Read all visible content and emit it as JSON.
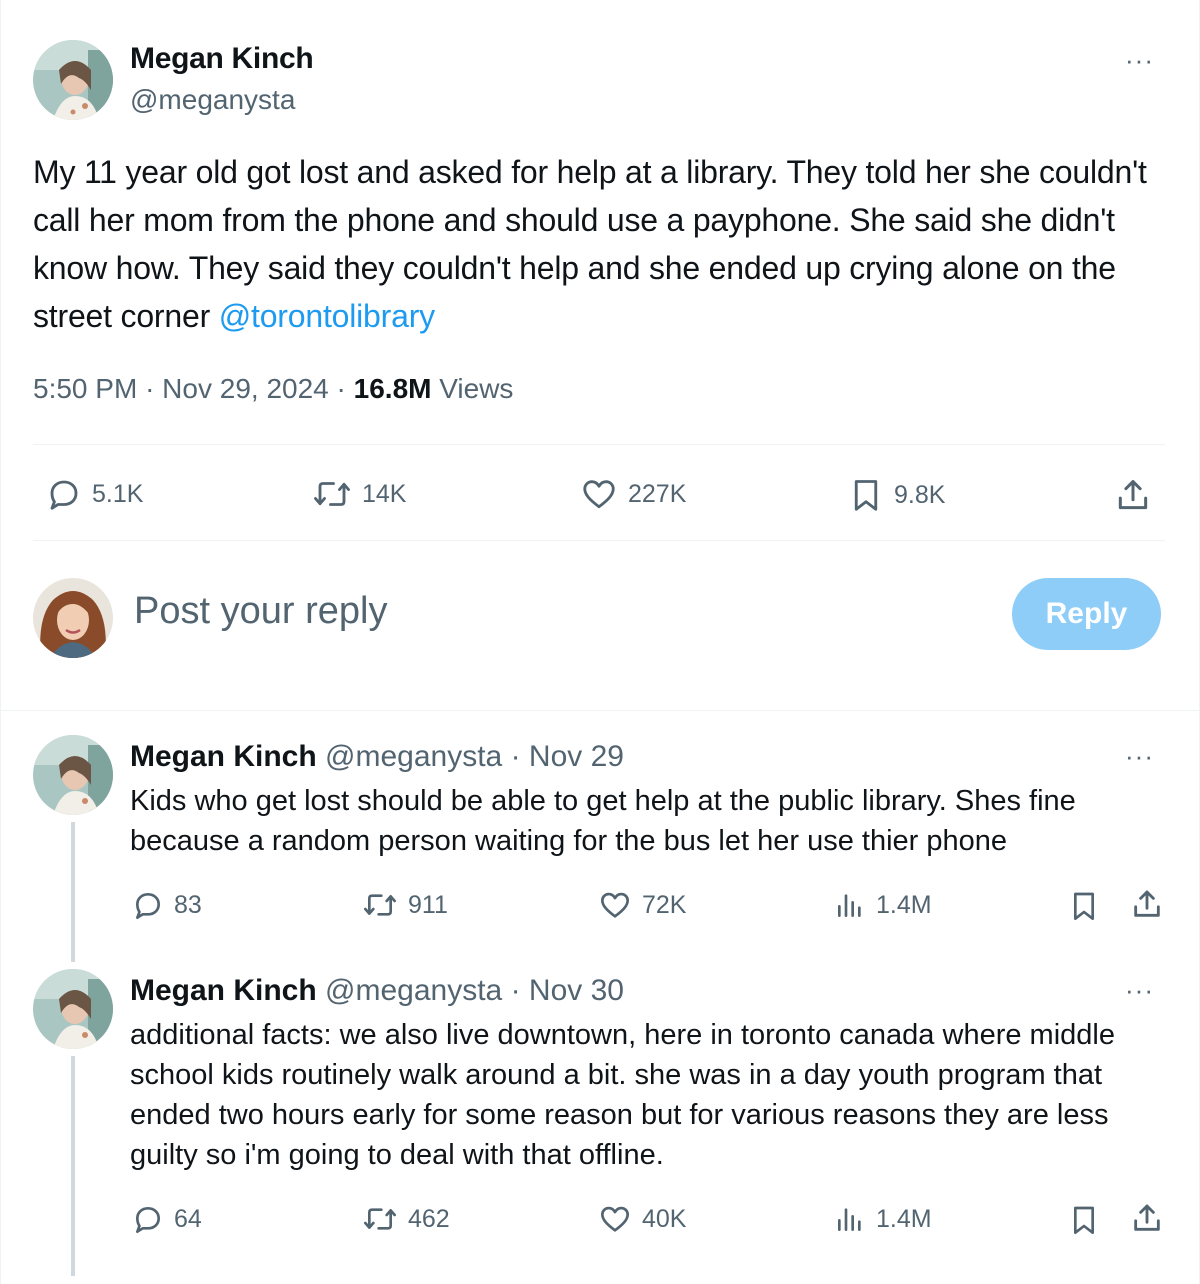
{
  "main_tweet": {
    "author_name": "Megan Kinch",
    "author_handle": "@meganysta",
    "text_before_mention": "My 11 year old got lost and asked for help at a library. They told her she couldn't call her mom from the phone and should use a payphone. She said she didn't know how. They said they couldn't help and she ended up crying alone on the street corner ",
    "mention": "@torontolibrary",
    "time": "5:50 PM",
    "date": "Nov 29, 2024",
    "views_count": "16.8M",
    "views_label": "Views",
    "separator": "·",
    "more_glyph": "···",
    "stats": {
      "replies": "5.1K",
      "retweets": "14K",
      "likes": "227K",
      "bookmarks": "9.8K"
    }
  },
  "reply_composer": {
    "placeholder": "Post your reply",
    "button_label": "Reply"
  },
  "thread_replies": [
    {
      "author_name": "Megan Kinch",
      "author_handle": "@meganysta",
      "date": "Nov 29",
      "text": "Kids who get lost should be able to get help at the public library. Shes fine because a random person waiting for the bus let her use thier phone",
      "stats": {
        "replies": "83",
        "retweets": "911",
        "likes": "72K",
        "views": "1.4M"
      }
    },
    {
      "author_name": "Megan Kinch",
      "author_handle": "@meganysta",
      "date": "Nov 30",
      "text": "additional facts: we also live downtown, here in toronto canada where middle school kids routinely walk around a bit. she was in a day youth program that ended two hours early for some reason but for various reasons they are less guilty so i'm going to deal with that offline.",
      "stats": {
        "replies": "64",
        "retweets": "462",
        "likes": "40K",
        "views": "1.4M"
      }
    }
  ],
  "colors": {
    "text": "#0f1419",
    "secondary": "#536471",
    "link": "#1d9bf0",
    "reply_button": "#8ecdf8",
    "divider": "#eff3f4",
    "thread_line": "#cfd9de"
  },
  "icons": [
    "comment-icon",
    "retweet-icon",
    "heart-icon",
    "bookmark-icon",
    "share-icon",
    "views-icon",
    "more-icon"
  ]
}
